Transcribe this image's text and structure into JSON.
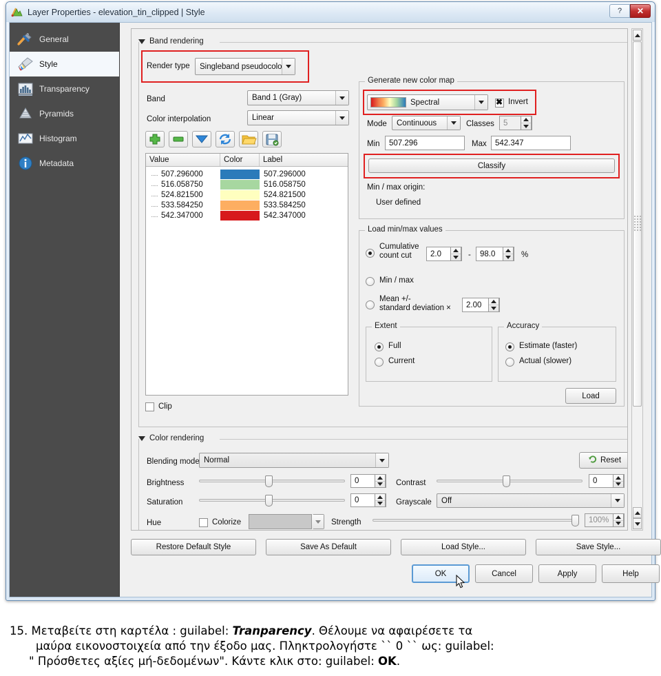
{
  "window": {
    "title": "Layer Properties - elevation_tin_clipped | Style",
    "icon": "qgis-layer-icon",
    "help_btn": "?",
    "close_btn": "✕"
  },
  "sidebar": {
    "items": [
      {
        "label": "General",
        "icon": "hammer-screwdriver-icon",
        "active": false
      },
      {
        "label": "Style",
        "icon": "paint-brush-icon",
        "active": true
      },
      {
        "label": "Transparency",
        "icon": "histogram-bars-icon",
        "active": false
      },
      {
        "label": "Pyramids",
        "icon": "pyramid-stack-icon",
        "active": false
      },
      {
        "label": "Histogram",
        "icon": "line-chart-icon",
        "active": false
      },
      {
        "label": "Metadata",
        "icon": "info-circle-icon",
        "active": false
      }
    ]
  },
  "band_rendering": {
    "section_title": "Band rendering",
    "render_type_label": "Render type",
    "render_type_value": "Singleband pseudocolor",
    "band_label": "Band",
    "band_value": "Band 1 (Gray)",
    "interpolation_label": "Color interpolation",
    "interpolation_value": "Linear",
    "toolbar": [
      {
        "name": "add-entry-button",
        "icon": "green-plus-icon"
      },
      {
        "name": "remove-entry-button",
        "icon": "green-minus-icon"
      },
      {
        "name": "sort-entries-button",
        "icon": "blue-down-arrow-icon"
      },
      {
        "name": "reload-button",
        "icon": "blue-refresh-icon"
      },
      {
        "name": "load-colormap-button",
        "icon": "yellow-folder-icon"
      },
      {
        "name": "save-colormap-button",
        "icon": "floppy-disk-icon"
      }
    ],
    "table": {
      "headers": [
        "Value",
        "Color",
        "Label"
      ],
      "rows": [
        {
          "value": "507.296000",
          "color": "#2b7bba",
          "label": "507.296000"
        },
        {
          "value": "516.058750",
          "color": "#a7d7a0",
          "label": "516.058750"
        },
        {
          "value": "524.821500",
          "color": "#ffffbf",
          "label": "524.821500"
        },
        {
          "value": "533.584250",
          "color": "#fdae61",
          "label": "533.584250"
        },
        {
          "value": "542.347000",
          "color": "#d7191c",
          "label": "542.347000"
        }
      ]
    },
    "clip_label": "Clip",
    "clip_checked": false
  },
  "generate_color_map": {
    "section_title": "Generate new color map",
    "ramp_value": "Spectral",
    "ramp_colors": [
      "#d7191c",
      "#fdae61",
      "#ffffbf",
      "#a7d7a0",
      "#2b7bba"
    ],
    "invert_label": "Invert",
    "invert_checked": true,
    "mode_label": "Mode",
    "mode_value": "Continuous",
    "classes_label": "Classes",
    "classes_value": "5",
    "min_label": "Min",
    "min_value": "507.296",
    "max_label": "Max",
    "max_value": "542.347",
    "classify_button": "Classify",
    "origin_label": "Min / max origin:",
    "origin_value": "User defined"
  },
  "load_minmax": {
    "section_title": "Load min/max values",
    "cumulative_label": "Cumulative\ncount cut",
    "cumulative_selected": true,
    "cumulative_lo": "2.0",
    "cumulative_dash": "-",
    "cumulative_hi": "98.0",
    "percent_symbol": "%",
    "minmax_label": "Min / max",
    "minmax_selected": false,
    "stddev_label": "Mean +/-\nstandard deviation ×",
    "stddev_selected": false,
    "stddev_value": "2.00",
    "extent": {
      "title": "Extent",
      "options": [
        {
          "label": "Full",
          "selected": true
        },
        {
          "label": "Current",
          "selected": false
        }
      ]
    },
    "accuracy": {
      "title": "Accuracy",
      "options": [
        {
          "label": "Estimate (faster)",
          "selected": true
        },
        {
          "label": "Actual (slower)",
          "selected": false
        }
      ]
    },
    "load_button": "Load"
  },
  "color_rendering": {
    "section_title": "Color rendering",
    "blending_label": "Blending mode",
    "blending_value": "Normal",
    "reset_button": "Reset",
    "reset_icon": "undo-arrow-icon",
    "brightness_label": "Brightness",
    "brightness_value": "0",
    "contrast_label": "Contrast",
    "contrast_value": "0",
    "saturation_label": "Saturation",
    "saturation_value": "0",
    "grayscale_label": "Grayscale",
    "grayscale_value": "Off",
    "hue_label": "Hue",
    "colorize_label": "Colorize",
    "colorize_checked": false,
    "colorize_swatch": "#c8c8c8",
    "strength_label": "Strength",
    "strength_value": "100%"
  },
  "footer": {
    "style_buttons": [
      "Restore Default Style",
      "Save As Default",
      "Load Style...",
      "Save Style..."
    ],
    "dialog_buttons": [
      "OK",
      "Cancel",
      "Apply",
      "Help"
    ],
    "default_button": "OK"
  },
  "caption": {
    "number": "15.",
    "line1_a": "Μεταβείτε στη καρτέλα : guilabel: ",
    "line1_em": "Tranparency",
    "line1_b": ". Θέλουμε να αφαιρέσετε τα",
    "line2": "μαύρα εικονοστοιχεία από την έξοδο μας. Πληκτρολογήστε `` 0 `` ως: guilabel:",
    "line3_a": "\" Πρόσθετες αξίες μή-δεδομένων\". Κάντε κλικ στο: guilabel: ",
    "line3_b": "OK",
    "line3_c": "."
  }
}
